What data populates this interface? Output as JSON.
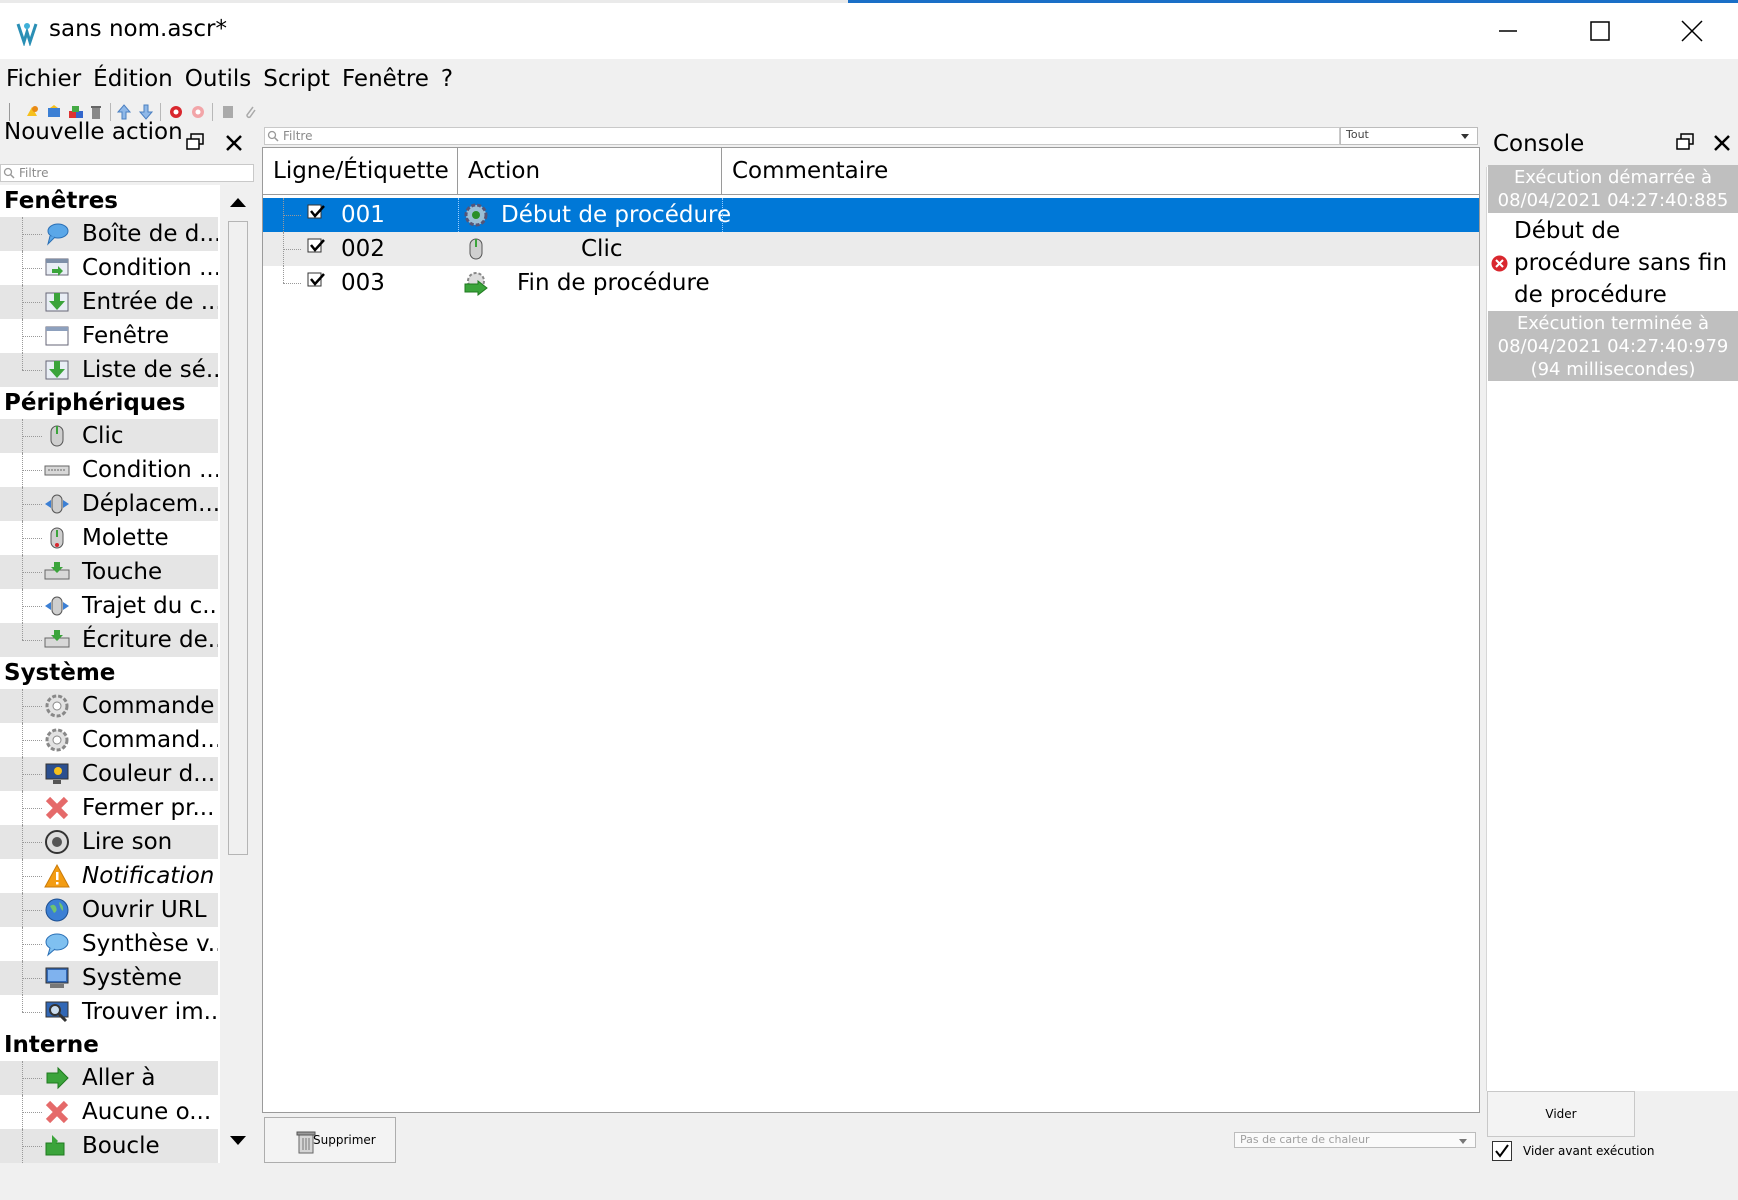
{
  "window": {
    "title": "sans nom.ascr*"
  },
  "menu": [
    "Fichier",
    "Édition",
    "Outils",
    "Script",
    "Fenêtre",
    "?"
  ],
  "left_panel": {
    "title": "Nouvelle action",
    "filter_placeholder": "Filtre",
    "categories": [
      {
        "name": "Fenêtres",
        "items": [
          {
            "label": "Boîte de d...",
            "icon": "dialog-box-icon"
          },
          {
            "label": "Condition ...",
            "icon": "window-condition-icon"
          },
          {
            "label": "Entrée de ...",
            "icon": "input-arrow-icon"
          },
          {
            "label": "Fenêtre",
            "icon": "window-icon"
          },
          {
            "label": "Liste de sé...",
            "icon": "list-select-icon"
          }
        ]
      },
      {
        "name": "Périphériques",
        "items": [
          {
            "label": "Clic",
            "icon": "mouse-click-icon"
          },
          {
            "label": "Condition ...",
            "icon": "keyboard-condition-icon"
          },
          {
            "label": "Déplacem...",
            "icon": "mouse-move-icon"
          },
          {
            "label": "Molette",
            "icon": "mouse-wheel-icon"
          },
          {
            "label": "Touche",
            "icon": "key-icon"
          },
          {
            "label": "Trajet du c...",
            "icon": "cursor-path-icon"
          },
          {
            "label": "Écriture de...",
            "icon": "keyboard-write-icon"
          }
        ]
      },
      {
        "name": "Système",
        "items": [
          {
            "label": "Commande",
            "icon": "gear-icon"
          },
          {
            "label": "Command...",
            "icon": "gear-icon"
          },
          {
            "label": "Couleur d...",
            "icon": "screen-color-icon"
          },
          {
            "label": "Fermer pr...",
            "icon": "close-process-icon"
          },
          {
            "label": "Lire son",
            "icon": "speaker-icon"
          },
          {
            "label": "Notification",
            "icon": "warning-icon"
          },
          {
            "label": "Ouvrir URL",
            "icon": "globe-icon"
          },
          {
            "label": "Synthèse v...",
            "icon": "speech-bubble-icon"
          },
          {
            "label": "Système",
            "icon": "computer-icon"
          },
          {
            "label": "Trouver im...",
            "icon": "find-image-icon"
          }
        ]
      },
      {
        "name": "Interne",
        "items": [
          {
            "label": "Aller à",
            "icon": "goto-arrow-icon"
          },
          {
            "label": "Aucune o...",
            "icon": "red-x-icon"
          },
          {
            "label": "Boucle",
            "icon": "loop-icon"
          }
        ]
      }
    ]
  },
  "main": {
    "filter_placeholder": "Filtre",
    "filter_scope": "Tout",
    "columns": [
      "Ligne/Étiquette",
      "Action",
      "Commentaire"
    ],
    "rows": [
      {
        "line": "001",
        "action": "Début de procédure",
        "comment": "",
        "icon": "procedure-start-icon",
        "selected": true
      },
      {
        "line": "002",
        "action": "Clic",
        "comment": "",
        "icon": "mouse-click-icon",
        "selected": false
      },
      {
        "line": "003",
        "action": "Fin de procédure",
        "comment": "",
        "icon": "procedure-end-icon",
        "selected": false
      }
    ],
    "delete_button": "Supprimer",
    "heatmap_select": "Pas de carte de chaleur"
  },
  "console": {
    "title": "Console",
    "start_banner": "Exécution démarrée à 08/04/2021 04:27:40:885",
    "message": "Début de procédure sans fin de procédure",
    "end_banner": "Exécution terminée à 08/04/2021 04:27:40:979 (94 millisecondes)",
    "clear_button": "Vider",
    "clear_before_run_label": "Vider avant exécution",
    "clear_before_run_checked": true
  },
  "colors": {
    "selection": "#0078d7",
    "banner": "#bfbfbf",
    "error": "#d9272e"
  }
}
